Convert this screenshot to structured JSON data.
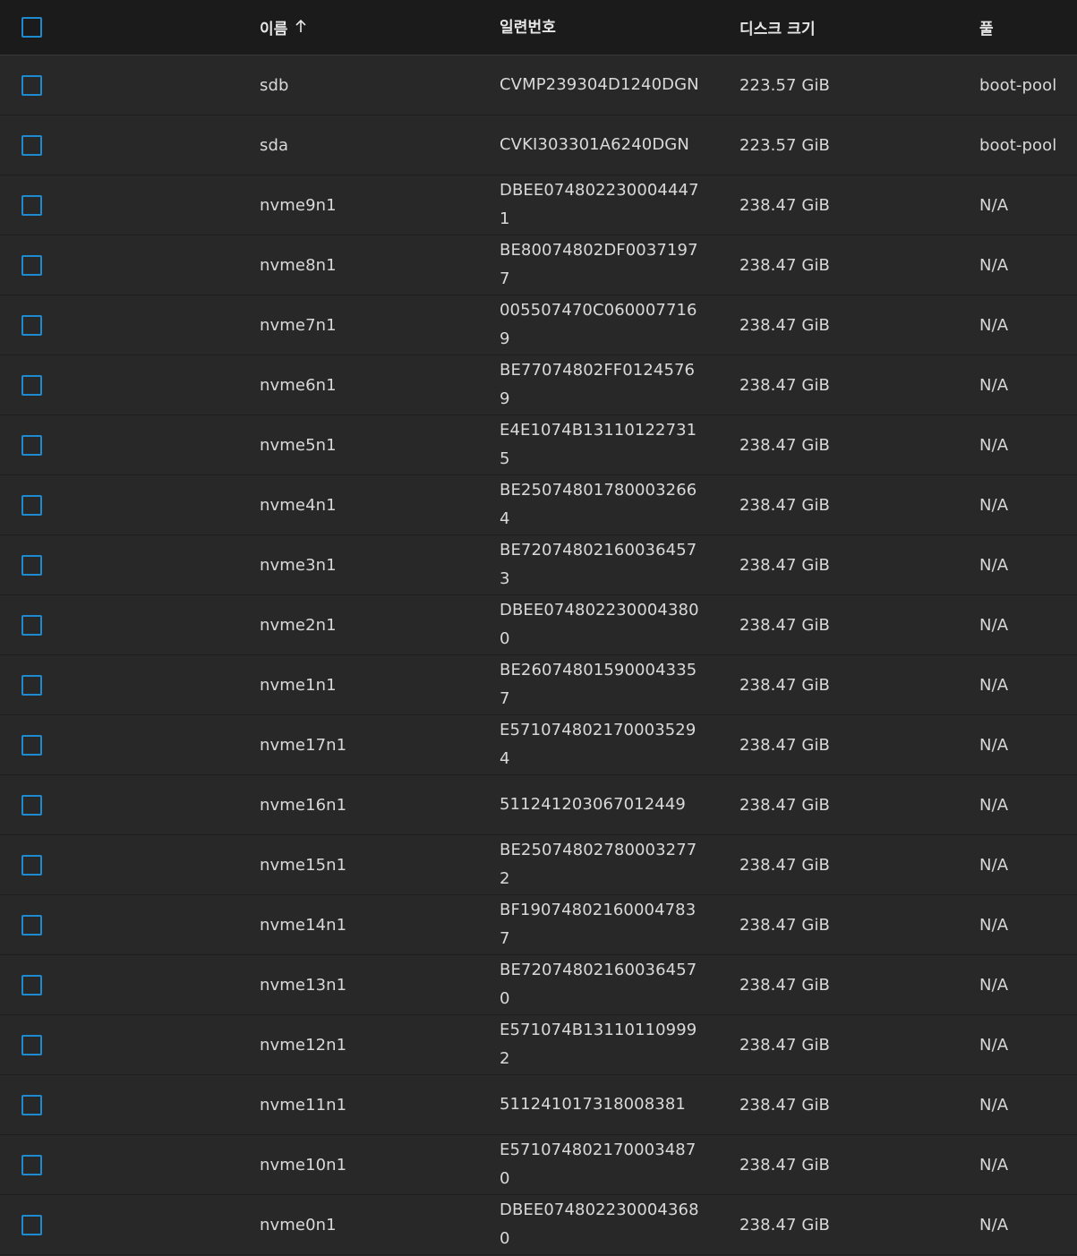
{
  "table": {
    "columns": {
      "name": "이름",
      "serial": "일련번호",
      "size": "디스크 크기",
      "pool": "풀"
    },
    "sort_icon": "arrow-up-icon",
    "rows": [
      {
        "name": "sdb",
        "serial": "CVMP239304D1240DGN",
        "size": "223.57 GiB",
        "pool": "boot-pool"
      },
      {
        "name": "sda",
        "serial": "CVKI303301A6240DGN",
        "size": "223.57 GiB",
        "pool": "boot-pool"
      },
      {
        "name": "nvme9n1",
        "serial": "DBEE0748022300044471",
        "size": "238.47 GiB",
        "pool": "N/A"
      },
      {
        "name": "nvme8n1",
        "serial": "BE80074802DF00371977",
        "size": "238.47 GiB",
        "pool": "N/A"
      },
      {
        "name": "nvme7n1",
        "serial": "005507470C0600077169",
        "size": "238.47 GiB",
        "pool": "N/A"
      },
      {
        "name": "nvme6n1",
        "serial": "BE77074802FF01245769",
        "size": "238.47 GiB",
        "pool": "N/A"
      },
      {
        "name": "nvme5n1",
        "serial": "E4E1074B131101227315",
        "size": "238.47 GiB",
        "pool": "N/A"
      },
      {
        "name": "nvme4n1",
        "serial": "BE250748017800032664",
        "size": "238.47 GiB",
        "pool": "N/A"
      },
      {
        "name": "nvme3n1",
        "serial": "BE720748021600364573",
        "size": "238.47 GiB",
        "pool": "N/A"
      },
      {
        "name": "nvme2n1",
        "serial": "DBEE0748022300043800",
        "size": "238.47 GiB",
        "pool": "N/A"
      },
      {
        "name": "nvme1n1",
        "serial": "BE260748015900043357",
        "size": "238.47 GiB",
        "pool": "N/A"
      },
      {
        "name": "nvme17n1",
        "serial": "E5710748021700035294",
        "size": "238.47 GiB",
        "pool": "N/A"
      },
      {
        "name": "nvme16n1",
        "serial": "511241203067012449",
        "size": "238.47 GiB",
        "pool": "N/A"
      },
      {
        "name": "nvme15n1",
        "serial": "BE250748027800032772",
        "size": "238.47 GiB",
        "pool": "N/A"
      },
      {
        "name": "nvme14n1",
        "serial": "BF190748021600047837",
        "size": "238.47 GiB",
        "pool": "N/A"
      },
      {
        "name": "nvme13n1",
        "serial": "BE720748021600364570",
        "size": "238.47 GiB",
        "pool": "N/A"
      },
      {
        "name": "nvme12n1",
        "serial": "E571074B131101109992",
        "size": "238.47 GiB",
        "pool": "N/A"
      },
      {
        "name": "nvme11n1",
        "serial": "511241017318008381",
        "size": "238.47 GiB",
        "pool": "N/A"
      },
      {
        "name": "nvme10n1",
        "serial": "E5710748021700034870",
        "size": "238.47 GiB",
        "pool": "N/A"
      },
      {
        "name": "nvme0n1",
        "serial": "DBEE0748022300043680",
        "size": "238.47 GiB",
        "pool": "N/A"
      }
    ]
  }
}
